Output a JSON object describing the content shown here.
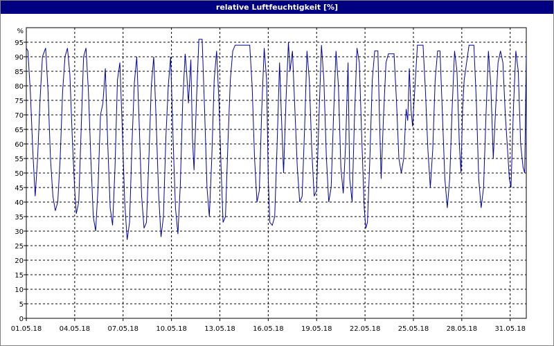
{
  "window": {
    "title": "relative Luftfeuchtigkeit [%]"
  },
  "chart_data": {
    "type": "line",
    "title": "relative Luftfeuchtigkeit [%]",
    "ylabel": "%",
    "xlabel": "",
    "ylim": [
      0,
      100
    ],
    "xlim": [
      "2018-05-01",
      "2018-06-01"
    ],
    "grid": true,
    "colors": {
      "line": "#0000a0",
      "grid": "#000000",
      "background": "#ffffff"
    },
    "yticks": [
      0,
      5,
      10,
      15,
      20,
      25,
      30,
      35,
      40,
      45,
      50,
      55,
      60,
      65,
      70,
      75,
      80,
      85,
      90,
      95
    ],
    "xtick_labels": [
      "01.05.18",
      "04.05.18",
      "07.05.18",
      "10.05.18",
      "13.05.18",
      "16.05.18",
      "19.05.18",
      "22.05.18",
      "25.05.18",
      "28.05.18",
      "31.05.18"
    ],
    "series": [
      {
        "values": [
          [
            1.0,
            93
          ],
          [
            1.1,
            92
          ],
          [
            1.25,
            78
          ],
          [
            1.4,
            58
          ],
          [
            1.55,
            42
          ],
          [
            1.7,
            55
          ],
          [
            1.85,
            75
          ],
          [
            2.0,
            90
          ],
          [
            2.2,
            93
          ],
          [
            2.35,
            78
          ],
          [
            2.5,
            55
          ],
          [
            2.65,
            42
          ],
          [
            2.8,
            37
          ],
          [
            2.95,
            40
          ],
          [
            3.1,
            55
          ],
          [
            3.25,
            78
          ],
          [
            3.4,
            90
          ],
          [
            3.55,
            93
          ],
          [
            3.7,
            84
          ],
          [
            3.85,
            62
          ],
          [
            4.0,
            44
          ],
          [
            4.1,
            36
          ],
          [
            4.25,
            40
          ],
          [
            4.4,
            65
          ],
          [
            4.55,
            90
          ],
          [
            4.7,
            93
          ],
          [
            4.85,
            78
          ],
          [
            5.0,
            55
          ],
          [
            5.15,
            35
          ],
          [
            5.3,
            30
          ],
          [
            5.45,
            45
          ],
          [
            5.6,
            70
          ],
          [
            5.75,
            74
          ],
          [
            5.9,
            86
          ],
          [
            6.05,
            60
          ],
          [
            6.2,
            38
          ],
          [
            6.35,
            32
          ],
          [
            6.5,
            52
          ],
          [
            6.65,
            82
          ],
          [
            6.8,
            88
          ],
          [
            6.95,
            65
          ],
          [
            7.1,
            40
          ],
          [
            7.25,
            27
          ],
          [
            7.4,
            33
          ],
          [
            7.55,
            60
          ],
          [
            7.7,
            81
          ],
          [
            7.85,
            90
          ],
          [
            8.0,
            67
          ],
          [
            8.15,
            42
          ],
          [
            8.3,
            31
          ],
          [
            8.45,
            33
          ],
          [
            8.6,
            55
          ],
          [
            8.75,
            80
          ],
          [
            8.9,
            90
          ],
          [
            9.05,
            68
          ],
          [
            9.2,
            43
          ],
          [
            9.35,
            28
          ],
          [
            9.5,
            35
          ],
          [
            9.65,
            62
          ],
          [
            9.8,
            80
          ],
          [
            9.95,
            90
          ],
          [
            10.1,
            62
          ],
          [
            10.25,
            38
          ],
          [
            10.4,
            29
          ],
          [
            10.55,
            46
          ],
          [
            10.7,
            75
          ],
          [
            10.85,
            91
          ],
          [
            10.95,
            84
          ],
          [
            11.05,
            74
          ],
          [
            11.2,
            89
          ],
          [
            11.3,
            62
          ],
          [
            11.4,
            51
          ],
          [
            11.55,
            75
          ],
          [
            11.7,
            96
          ],
          [
            11.9,
            96
          ],
          [
            12.05,
            72
          ],
          [
            12.2,
            45
          ],
          [
            12.35,
            35
          ],
          [
            12.5,
            55
          ],
          [
            12.65,
            82
          ],
          [
            12.8,
            92
          ],
          [
            12.95,
            74
          ],
          [
            13.1,
            48
          ],
          [
            13.2,
            33
          ],
          [
            13.35,
            35
          ],
          [
            13.5,
            60
          ],
          [
            13.65,
            82
          ],
          [
            13.8,
            92
          ],
          [
            13.95,
            94
          ],
          [
            14.4,
            94
          ],
          [
            14.85,
            94
          ],
          [
            15.0,
            80
          ],
          [
            15.15,
            55
          ],
          [
            15.3,
            40
          ],
          [
            15.45,
            44
          ],
          [
            15.6,
            72
          ],
          [
            15.75,
            93
          ],
          [
            15.9,
            82
          ],
          [
            16.0,
            48
          ],
          [
            16.1,
            33
          ],
          [
            16.25,
            32
          ],
          [
            16.4,
            35
          ],
          [
            16.55,
            60
          ],
          [
            16.7,
            88
          ],
          [
            16.8,
            72
          ],
          [
            16.95,
            50
          ],
          [
            17.1,
            75
          ],
          [
            17.25,
            95
          ],
          [
            17.35,
            85
          ],
          [
            17.5,
            92
          ],
          [
            17.65,
            72
          ],
          [
            17.8,
            52
          ],
          [
            17.95,
            40
          ],
          [
            18.1,
            42
          ],
          [
            18.25,
            65
          ],
          [
            18.4,
            92
          ],
          [
            18.55,
            82
          ],
          [
            18.7,
            58
          ],
          [
            18.85,
            42
          ],
          [
            19.0,
            44
          ],
          [
            19.15,
            70
          ],
          [
            19.3,
            94
          ],
          [
            19.45,
            82
          ],
          [
            19.6,
            56
          ],
          [
            19.75,
            40
          ],
          [
            19.9,
            45
          ],
          [
            20.05,
            70
          ],
          [
            20.2,
            92
          ],
          [
            20.35,
            80
          ],
          [
            20.5,
            52
          ],
          [
            20.65,
            43
          ],
          [
            20.8,
            60
          ],
          [
            20.95,
            88
          ],
          [
            21.05,
            48
          ],
          [
            21.2,
            40
          ],
          [
            21.35,
            70
          ],
          [
            21.5,
            93
          ],
          [
            21.65,
            88
          ],
          [
            21.8,
            62
          ],
          [
            21.95,
            38
          ],
          [
            22.05,
            31
          ],
          [
            22.15,
            33
          ],
          [
            22.3,
            55
          ],
          [
            22.45,
            82
          ],
          [
            22.6,
            92
          ],
          [
            22.8,
            92
          ],
          [
            22.9,
            68
          ],
          [
            23.0,
            48
          ],
          [
            23.15,
            70
          ],
          [
            23.3,
            88
          ],
          [
            23.45,
            91
          ],
          [
            23.8,
            91
          ],
          [
            23.95,
            75
          ],
          [
            24.1,
            55
          ],
          [
            24.25,
            50
          ],
          [
            24.4,
            55
          ],
          [
            24.55,
            72
          ],
          [
            24.65,
            68
          ],
          [
            24.75,
            86
          ],
          [
            24.85,
            72
          ],
          [
            24.95,
            66
          ],
          [
            25.1,
            80
          ],
          [
            25.25,
            94
          ],
          [
            25.6,
            94
          ],
          [
            25.75,
            78
          ],
          [
            25.9,
            58
          ],
          [
            26.05,
            45
          ],
          [
            26.2,
            58
          ],
          [
            26.35,
            82
          ],
          [
            26.5,
            92
          ],
          [
            26.65,
            92
          ],
          [
            26.8,
            70
          ],
          [
            26.95,
            48
          ],
          [
            27.1,
            38
          ],
          [
            27.25,
            48
          ],
          [
            27.4,
            72
          ],
          [
            27.55,
            92
          ],
          [
            27.7,
            85
          ],
          [
            27.85,
            60
          ],
          [
            27.95,
            50
          ],
          [
            28.05,
            72
          ],
          [
            28.15,
            82
          ],
          [
            28.3,
            88
          ],
          [
            28.45,
            94
          ],
          [
            28.75,
            94
          ],
          [
            28.9,
            75
          ],
          [
            29.05,
            48
          ],
          [
            29.2,
            38
          ],
          [
            29.35,
            45
          ],
          [
            29.5,
            70
          ],
          [
            29.65,
            92
          ],
          [
            29.8,
            80
          ],
          [
            29.95,
            55
          ],
          [
            30.1,
            72
          ],
          [
            30.25,
            88
          ],
          [
            30.4,
            92
          ],
          [
            30.55,
            88
          ],
          [
            30.7,
            70
          ],
          [
            30.85,
            57
          ],
          [
            30.95,
            48
          ],
          [
            31.05,
            45
          ],
          [
            31.2,
            72
          ],
          [
            31.35,
            92
          ],
          [
            31.5,
            85
          ],
          [
            31.65,
            60
          ],
          [
            31.8,
            52
          ],
          [
            31.9,
            50
          ],
          [
            32.0,
            91
          ]
        ]
      }
    ]
  }
}
